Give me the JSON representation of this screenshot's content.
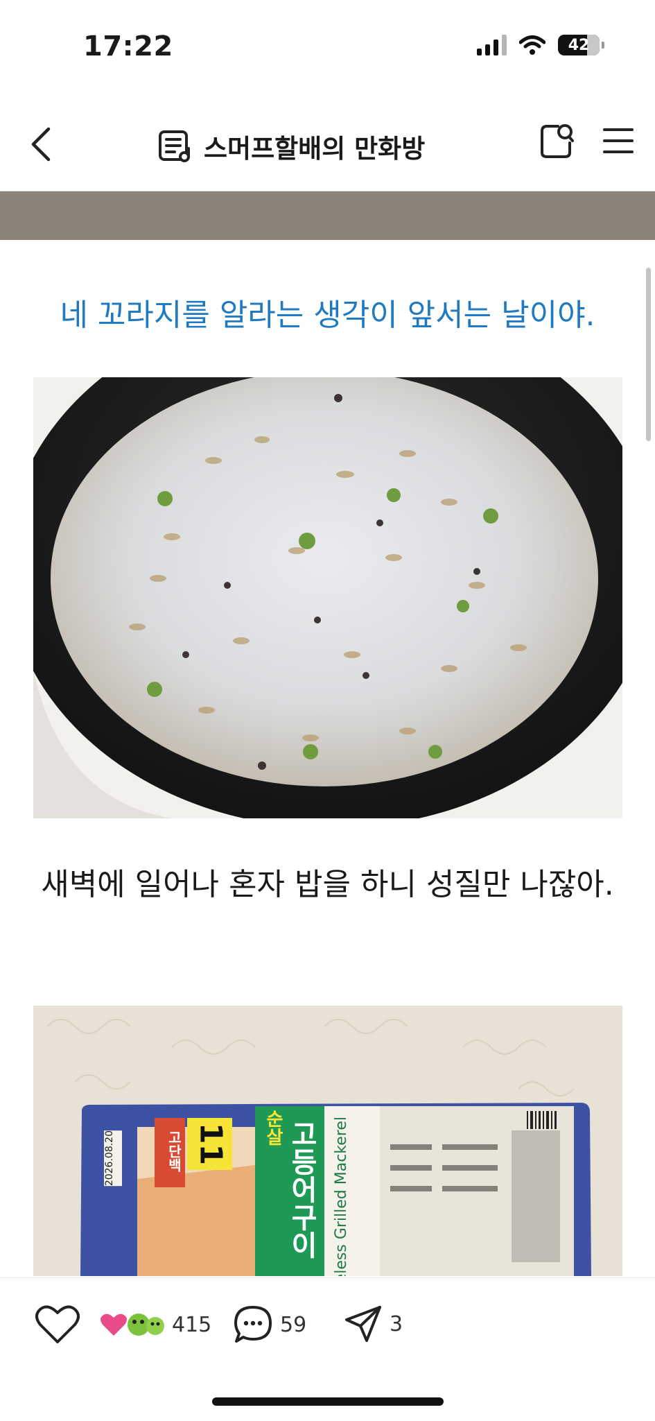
{
  "status": {
    "time": "17:22",
    "battery": "42"
  },
  "nav": {
    "title": "스머프할배의 만화방"
  },
  "post": {
    "caption_blue": "네 꼬라지를 알라는 생각이 앞서는 날이야.",
    "caption_black": "새벽에 일어나 혼자 밥을 하니 성질만 나잖아.",
    "package": {
      "badge": "고단백",
      "grams": "11",
      "brand_top": "순살",
      "name_ko": "고등어구이",
      "name_en": "Boneless Grilled Mackerel",
      "date": "2026.08.20"
    }
  },
  "actions": {
    "likes": "415",
    "comments": "59",
    "shares": "3"
  }
}
